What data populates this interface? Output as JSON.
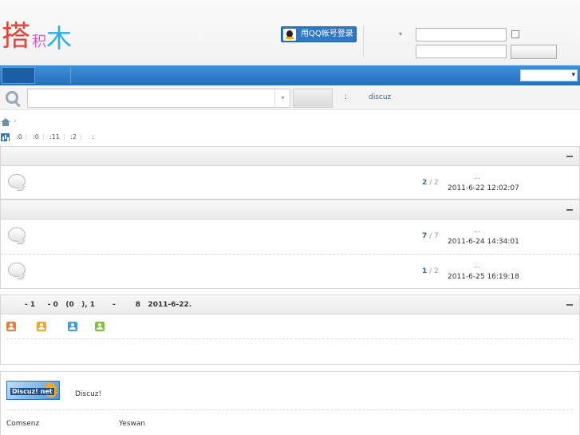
{
  "header": {
    "logo_chars": [
      "搭",
      "积",
      "木"
    ],
    "qq_login_label": "用QQ帐号登录",
    "login_dropdown_glyph": "▾"
  },
  "search": {
    "hot_colon": ":",
    "hot_link": "discuz"
  },
  "breadcrumb": {
    "separator": "›"
  },
  "stats": [
    "0",
    "0",
    "11",
    "2"
  ],
  "categories": [
    {
      "forums": [
        {
          "threads": "2",
          "posts": "2",
          "last_post_dots": "...",
          "last_post_time": "2011-6-22 12:02:07"
        }
      ]
    },
    {
      "forums": [
        {
          "threads": "7",
          "posts": "7",
          "last_post_dots": "...",
          "last_post_time": "2011-6-24 14:34:01"
        },
        {
          "threads": "1",
          "posts": "2",
          "last_post_dots": "...",
          "last_post_time": "2011-6-25 16:19:18"
        }
      ]
    }
  ],
  "online": {
    "title": "- 1     - 0   (0   ), 1       -        8   2011-6-22.",
    "user_icon_colors": [
      "#f07a3a",
      "#f5a623",
      "#3aa0e0",
      "#7cc23a"
    ]
  },
  "links": {
    "discuz_logo_text": "Discuz! net",
    "discuz_desc": "Discuz!",
    "text_links": [
      "Comsenz",
      "Yeswan"
    ]
  }
}
